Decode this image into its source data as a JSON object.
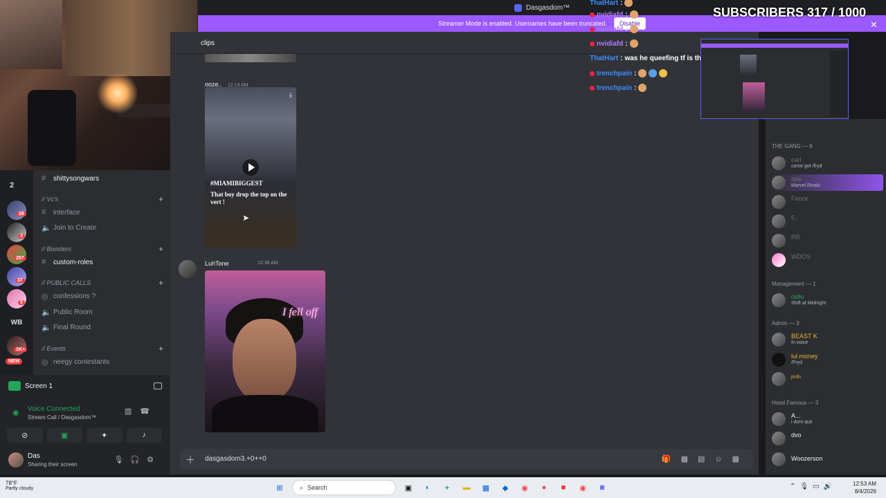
{
  "window": {
    "title": "Dasgasdom™"
  },
  "banner": {
    "text": "Streamer Mode is enabled. Usernames have been truncated.",
    "disable_label": "Disable"
  },
  "overlay": {
    "subscribers": "SUBSCRIBERS 317 / 1000",
    "chat": [
      {
        "user": "ThatHart",
        "text": ""
      },
      {
        "user": "nvidiafd",
        "text": ""
      },
      {
        "user": "nvidiafd",
        "text": ""
      },
      {
        "user": "nvidiafd",
        "text": ""
      },
      {
        "user": "ThatHart",
        "text": "was he queefing tf is that"
      },
      {
        "user": "trenchpain",
        "text": ""
      },
      {
        "user": "trenchpain",
        "text": ""
      }
    ]
  },
  "rail": {
    "folder_count": "2",
    "wb_label": "WB",
    "new_label": "NEW",
    "badges": [
      "28",
      "3",
      "257",
      "37",
      "5",
      "1K+"
    ]
  },
  "channels": {
    "shittysongwars": "shittysongwars",
    "cat_vcs": "// Vc's",
    "interface": "interface",
    "join_to_create": "Join to Create",
    "cat_boosters": "// Boosters",
    "custom_roles": "custom-roles",
    "cat_public": "// PUBLIC CALLS",
    "confessions": "confessions ?",
    "public_room": "Public Room",
    "final_round": "Final Round",
    "cat_events": "// Events",
    "neegy": "neegy contestants"
  },
  "voice": {
    "screen_label": "Screen 1",
    "status": "Voice Connected",
    "channel": "Stream Call / Dasgasdom™",
    "user_name": "Das",
    "user_status": "Sharing their screen"
  },
  "chat": {
    "channel_name": "clips",
    "msg1_author": "ooze..",
    "msg1_time": "12:14 AM",
    "vid1_tag": "#MIAMIBIGGEST",
    "vid1_caption": "That boy drop the top on the vert !",
    "msg2_author": "LuhTone",
    "msg2_time": "12:38 AM",
    "vid2_neon": "I fell off",
    "composer_value": "dasgasdom3.+0++0"
  },
  "members": {
    "groups": [
      {
        "title": "THE GANG — 6"
      },
      {
        "title": "Management — 1"
      },
      {
        "title": "Admin — 3"
      },
      {
        "title": "Hood Famous — 3"
      }
    ],
    "gang": [
      {
        "name": "carl",
        "activity": "come get /fryd"
      },
      {
        "name": "dde",
        "activity": "Marvel Rivals"
      },
      {
        "name": "Fance",
        "activity": ""
      },
      {
        "name": "F..",
        "activity": ""
      },
      {
        "name": "PR",
        "activity": ""
      },
      {
        "name": "WDOS",
        "activity": ""
      }
    ],
    "management": [
      {
        "name": "cello",
        "activity": "Shift at Midnight"
      }
    ],
    "admin": [
      {
        "name": "BEAST K",
        "activity": "In voice"
      },
      {
        "name": "lul money",
        "activity": "/Fryd"
      },
      {
        "name": "jrrdn",
        "activity": ""
      }
    ],
    "hood": [
      {
        "name": "A...",
        "activity": "i dont quit"
      },
      {
        "name": "dvo",
        "activity": ""
      },
      {
        "name": "Woozerson",
        "activity": ""
      }
    ]
  },
  "taskbar": {
    "temp": "78°F",
    "weather": "Partly cloudy",
    "search_label": "Search",
    "time": "12:53 AM",
    "date": "8/4/2026"
  }
}
